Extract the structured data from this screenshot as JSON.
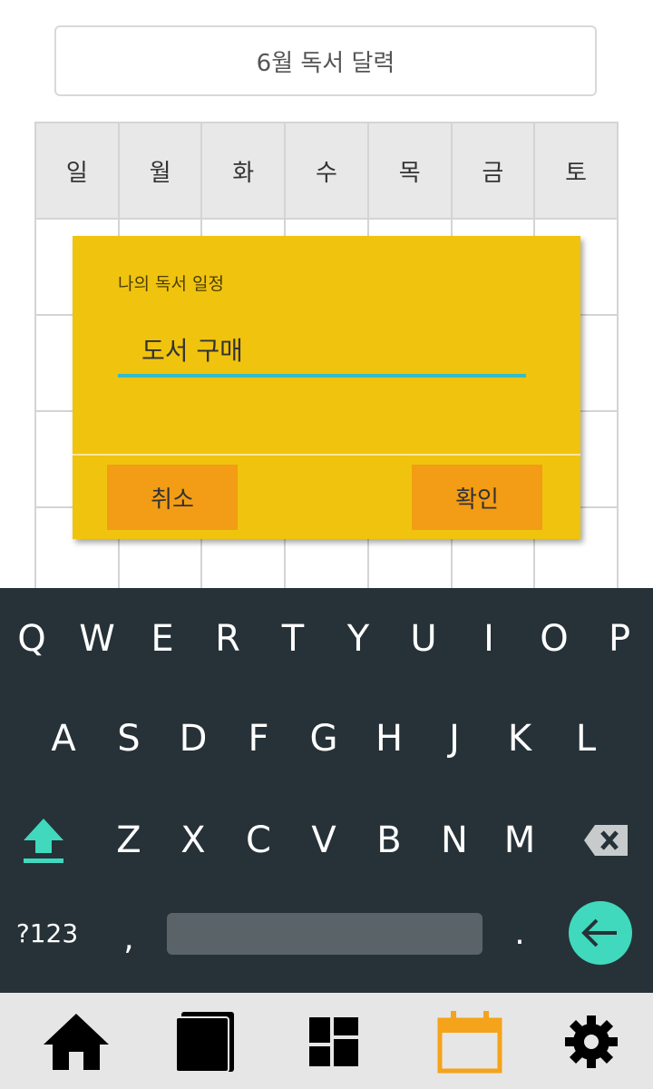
{
  "header": {
    "title": "6월 독서 달력"
  },
  "calendar": {
    "weekdays": [
      "일",
      "월",
      "화",
      "수",
      "목",
      "금",
      "토"
    ]
  },
  "dialog": {
    "label": "나의 독서 일정",
    "input_value": "도서 구매",
    "cancel_label": "취소",
    "ok_label": "확인",
    "accent_color": "#f0c30f",
    "button_color": "#f39c15",
    "underline_color": "#35bcc8"
  },
  "keyboard": {
    "row1": [
      "Q",
      "W",
      "E",
      "R",
      "T",
      "Y",
      "U",
      "I",
      "O",
      "P"
    ],
    "row2": [
      "A",
      "S",
      "D",
      "F",
      "G",
      "H",
      "J",
      "K",
      "L"
    ],
    "row3": [
      "Z",
      "X",
      "C",
      "V",
      "B",
      "N",
      "M"
    ],
    "symbols_label": "?123",
    "comma_label": ",",
    "period_label": ".",
    "shift_icon": "shift-up-arrow-icon",
    "backspace_icon": "backspace-icon",
    "enter_icon": "enter-arrow-icon",
    "background_color": "#263238",
    "accent_color": "#40d9bd"
  },
  "nav": {
    "items": [
      {
        "icon": "home-icon",
        "active": false
      },
      {
        "icon": "book-icon",
        "active": false
      },
      {
        "icon": "dashboard-icon",
        "active": false
      },
      {
        "icon": "calendar-icon",
        "active": true
      },
      {
        "icon": "gear-icon",
        "active": false
      }
    ],
    "active_color": "#f5a31a"
  }
}
